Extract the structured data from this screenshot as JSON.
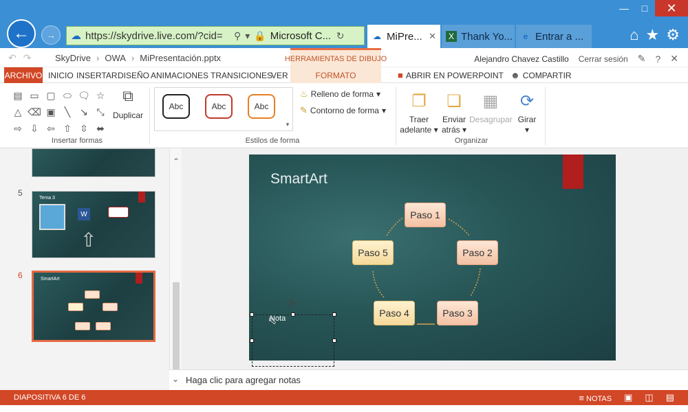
{
  "browser": {
    "url": "https://skydrive.live.com/?cid=",
    "site_label": "Microsoft C...",
    "tabs": [
      {
        "label": "MiPre..."
      },
      {
        "label": "Thank Yo..."
      },
      {
        "label": "Entrar a ..."
      }
    ]
  },
  "office": {
    "breadcrumb": [
      "SkyDrive",
      "OWA",
      "MiPresentación.pptx"
    ],
    "context_header": "HERRAMIENTAS DE DIBUJO",
    "user_name": "Alejandro Chavez Castillo",
    "signout": "Cerrar sesión"
  },
  "ribbon": {
    "tabs": [
      "ARCHIVO",
      "INICIO",
      "INSERTAR",
      "DISEÑO",
      "ANIMACIONES",
      "TRANSICIONES",
      "VER"
    ],
    "formato": "FORMATO",
    "open_in_ppt": "ABRIR EN POWERPOINT",
    "share": "COMPARTIR",
    "groups": {
      "insert_shapes": "Insertar formas",
      "shape_styles": "Estilos de forma",
      "arrange": "Organizar"
    },
    "duplicate": "Duplicar",
    "style_swatches": [
      "Abc",
      "Abc",
      "Abc"
    ],
    "shape_fill": "Relleno de forma",
    "shape_outline": "Contorno de forma",
    "bring_forward": [
      "Traer",
      "adelante"
    ],
    "send_backward": [
      "Enviar",
      "atrás"
    ],
    "ungroup": "Desagrupar",
    "rotate": "Girar"
  },
  "slides_panel": {
    "numbers": [
      "5",
      "6"
    ],
    "thumb5_title": "Tema 3",
    "thumb6_title": "SmartArt"
  },
  "slide": {
    "title": "SmartArt",
    "steps": [
      "Paso 1",
      "Paso 2",
      "Paso 3",
      "Paso 4",
      "Paso 5"
    ],
    "selection_text": "Nota"
  },
  "notes": {
    "placeholder": "Haga clic para agregar notas"
  },
  "status": {
    "slide_indicator": "DIAPOSITIVA 6 DE 6",
    "notes_button": "NOTAS"
  },
  "colors": {
    "accent": "#d24726",
    "browser_blue": "#3b8fd4",
    "slide_bg": "#275556",
    "step_fill": "#f3c1a4"
  }
}
